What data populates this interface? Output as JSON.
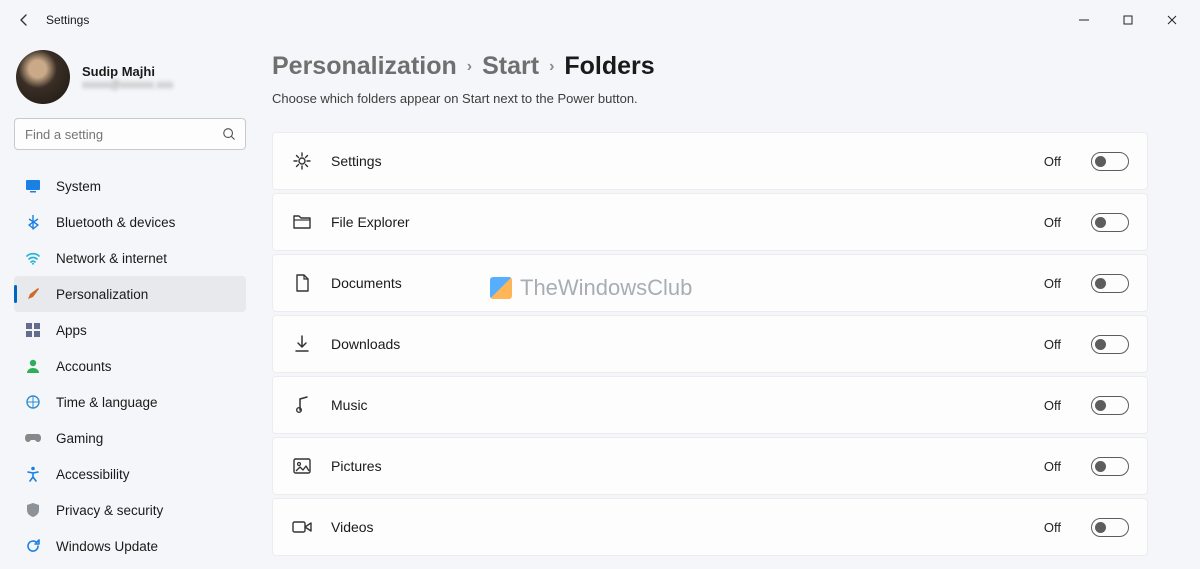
{
  "app_title": "Settings",
  "window_controls": {
    "minimize": "−",
    "maximize": "□",
    "close": "×"
  },
  "user": {
    "name": "Sudip Majhi",
    "email": "xxxxx@xxxxxx.xxx"
  },
  "search": {
    "placeholder": "Find a setting"
  },
  "nav": [
    {
      "key": "system",
      "label": "System",
      "icon_color": "#1b80e4",
      "active": false
    },
    {
      "key": "bluetooth",
      "label": "Bluetooth & devices",
      "icon_color": "#1b80e4",
      "active": false
    },
    {
      "key": "network",
      "label": "Network & internet",
      "icon_color": "#1b80e4",
      "active": false
    },
    {
      "key": "personalization",
      "label": "Personalization",
      "icon_color": "#d06a2a",
      "active": true
    },
    {
      "key": "apps",
      "label": "Apps",
      "icon_color": "#646e8c",
      "active": false
    },
    {
      "key": "accounts",
      "label": "Accounts",
      "icon_color": "#2fae59",
      "active": false
    },
    {
      "key": "time-language",
      "label": "Time & language",
      "icon_color": "#2e8cd4",
      "active": false
    },
    {
      "key": "gaming",
      "label": "Gaming",
      "icon_color": "#777777",
      "active": false
    },
    {
      "key": "accessibility",
      "label": "Accessibility",
      "icon_color": "#1b80e4",
      "active": false
    },
    {
      "key": "privacy",
      "label": "Privacy & security",
      "icon_color": "#7a7f86",
      "active": false
    },
    {
      "key": "windows-update",
      "label": "Windows Update",
      "icon_color": "#1b80e4",
      "active": false
    }
  ],
  "breadcrumb": {
    "parent1": "Personalization",
    "parent2": "Start",
    "current": "Folders"
  },
  "description": "Choose which folders appear on Start next to the Power button.",
  "toggle_state_label": "Off",
  "folders": [
    {
      "key": "settings",
      "label": "Settings",
      "state": "Off"
    },
    {
      "key": "file-explorer",
      "label": "File Explorer",
      "state": "Off"
    },
    {
      "key": "documents",
      "label": "Documents",
      "state": "Off"
    },
    {
      "key": "downloads",
      "label": "Downloads",
      "state": "Off"
    },
    {
      "key": "music",
      "label": "Music",
      "state": "Off"
    },
    {
      "key": "pictures",
      "label": "Pictures",
      "state": "Off"
    },
    {
      "key": "videos",
      "label": "Videos",
      "state": "Off"
    }
  ],
  "watermark": "TheWindowsClub"
}
